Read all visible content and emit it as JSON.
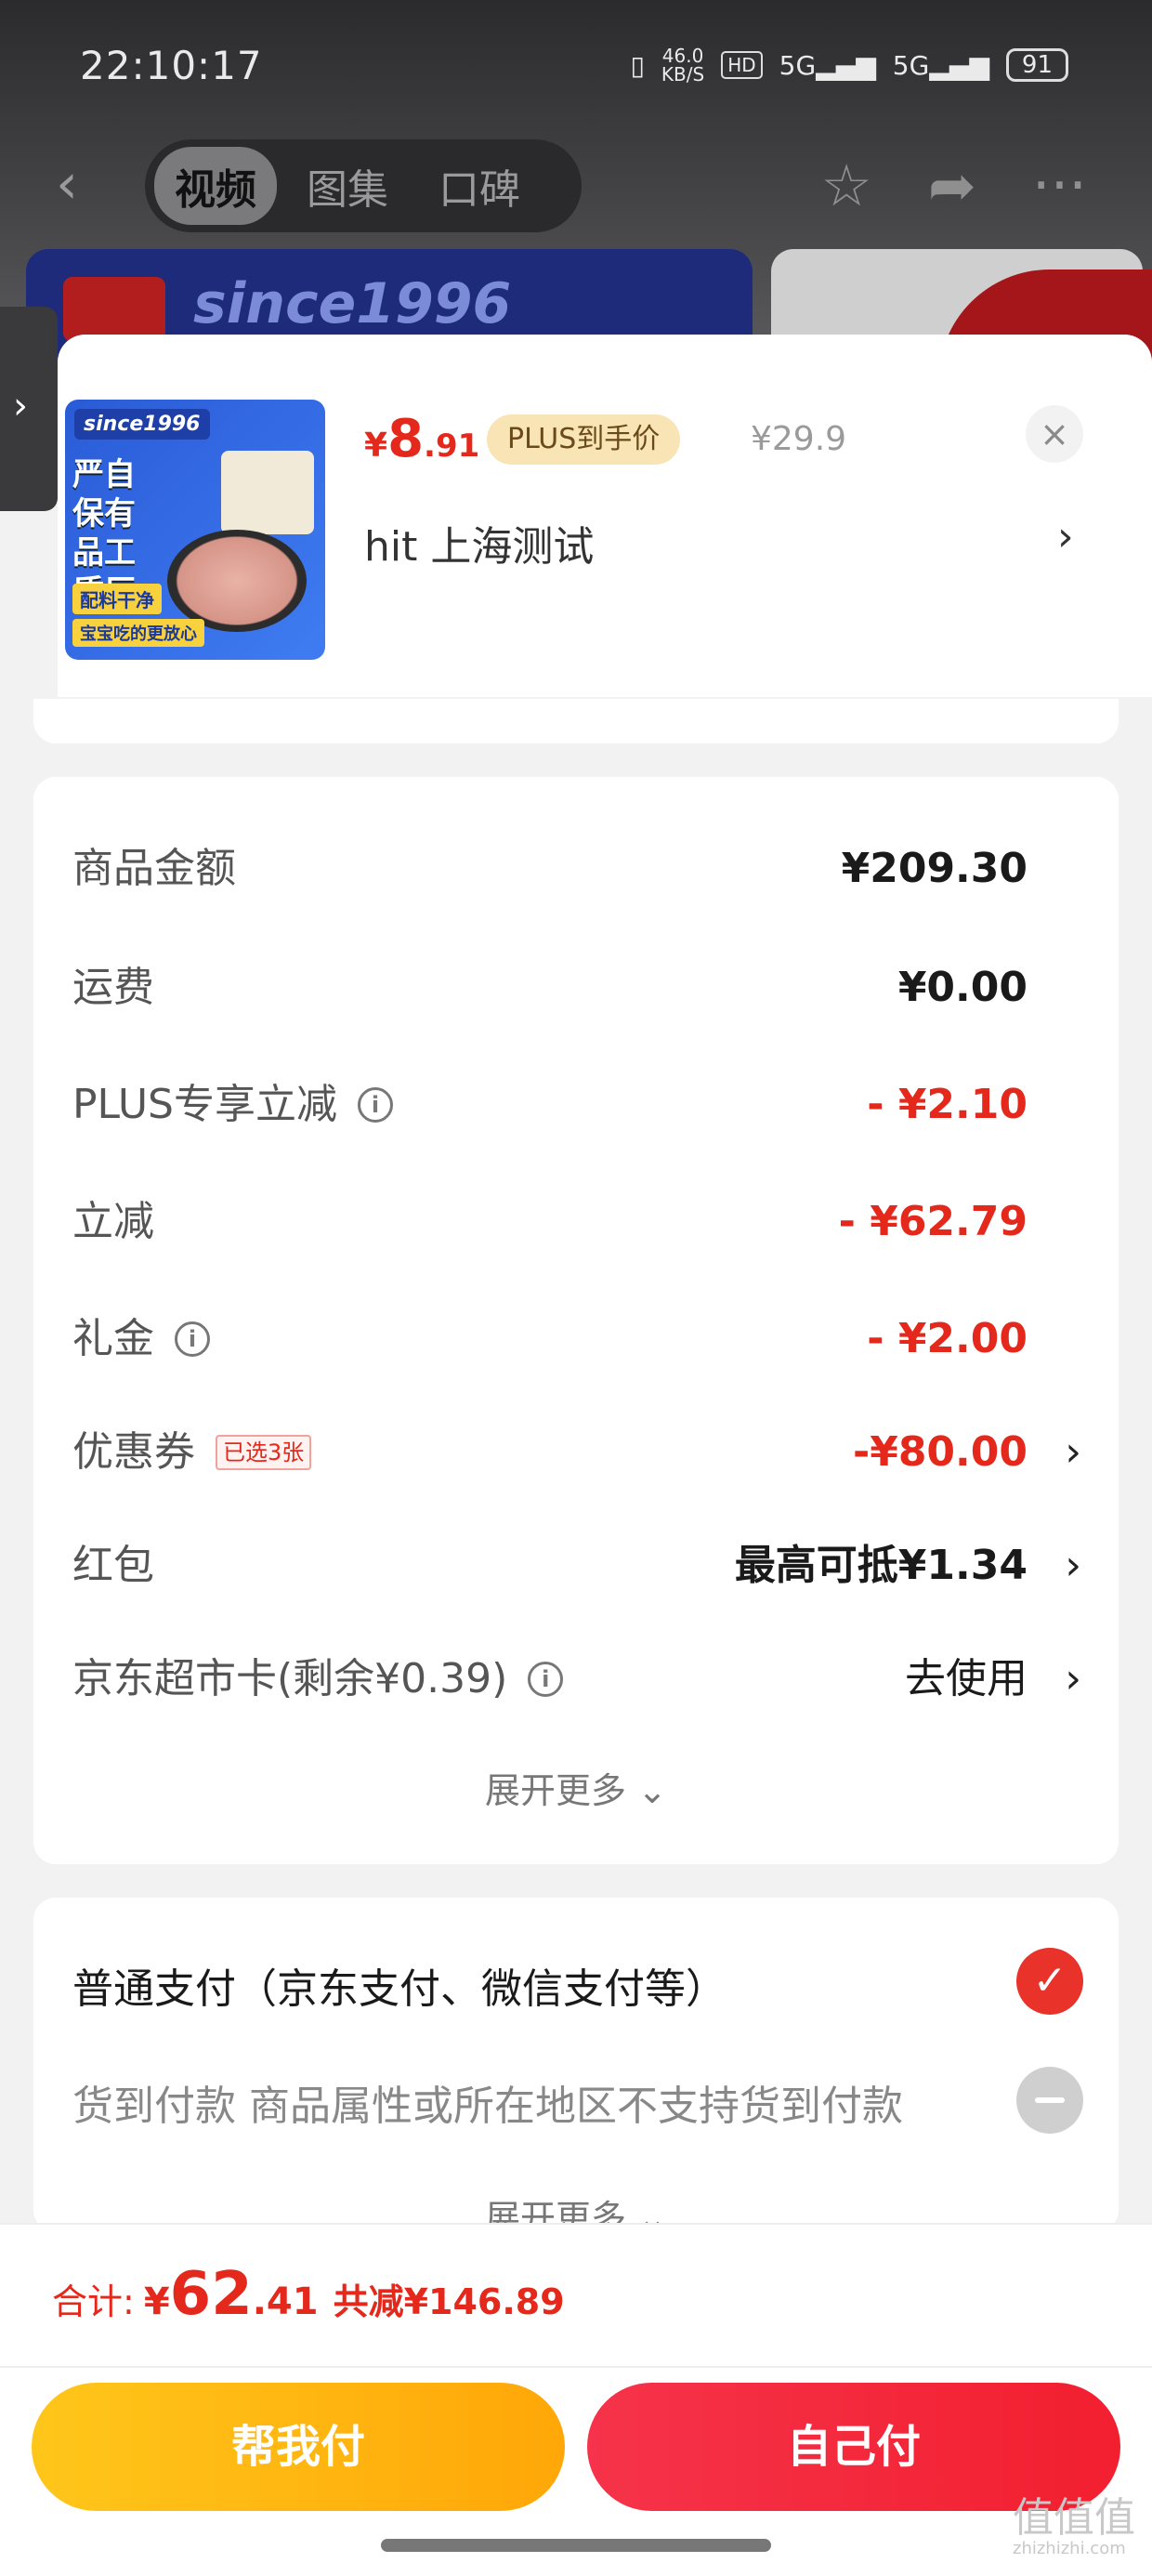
{
  "status_bar": {
    "time": "22:10:17",
    "net_speed": "46.0",
    "net_unit": "KB/S",
    "hd": "HD",
    "signal1": "5G",
    "signal2": "5G",
    "battery": "91"
  },
  "top_nav": {
    "tabs": [
      "视频",
      "图集",
      "口碑"
    ],
    "active_tab": 0
  },
  "banner": {
    "text": "since1996"
  },
  "product": {
    "thumb_brand": "since1996",
    "thumb_slogan": "严自保有品工质厂",
    "thumb_tag1": "配料干净",
    "thumb_tag2": "宝宝吃的更放心",
    "price_symbol": "¥",
    "price_int": "8",
    "price_dec": ".91",
    "plus_tag": "PLUS到手价",
    "original_price": "¥29.9",
    "shop": "hit  上海测试",
    "close": "×",
    "arrow": "›"
  },
  "amounts": [
    {
      "label": "商品金额",
      "value": "¥209.30",
      "style": "bold"
    },
    {
      "label": "运费",
      "value": "¥0.00",
      "style": "bold"
    },
    {
      "label": "PLUS专享立减",
      "value": "- ¥2.10",
      "style": "red",
      "info": true
    },
    {
      "label": "立减",
      "value": "- ¥62.79",
      "style": "red"
    },
    {
      "label": "礼金",
      "value": "- ¥2.00",
      "style": "red",
      "info": true
    },
    {
      "label": "优惠券",
      "badge": "已选3张",
      "value": "-¥80.00",
      "style": "red",
      "arrow": "›"
    },
    {
      "label": "红包",
      "value": "最高可抵¥1.34",
      "style": "bold",
      "arrow": "›"
    },
    {
      "label": "京东超市卡(剩余¥0.39)",
      "value": "去使用",
      "style": "normal",
      "arrow": "›",
      "info": true
    }
  ],
  "expand_more": "展开更多 ⌄",
  "payment": {
    "option1": "普通支付（京东支付、微信支付等）",
    "option2": "货到付款 商品属性或所在地区不支持货到付款",
    "expand_more": "展开更多 ⌄",
    "check": "✓"
  },
  "bottom": {
    "total_label": "合计:",
    "total_symbol": "¥",
    "total_int": "62",
    "total_dec": ".41",
    "total_reduce": "共减¥146.89",
    "btn_help": "帮我付",
    "btn_self": "自己付"
  },
  "watermark": {
    "logo": "值值值",
    "site": "zhizhizhi.com"
  },
  "info_glyph": "i",
  "colors": {
    "accent_red": "#e4281b",
    "help_button": "#ffb30f",
    "self_button": "#f42a3b",
    "plus_tag_bg": "#f8e4b5"
  }
}
